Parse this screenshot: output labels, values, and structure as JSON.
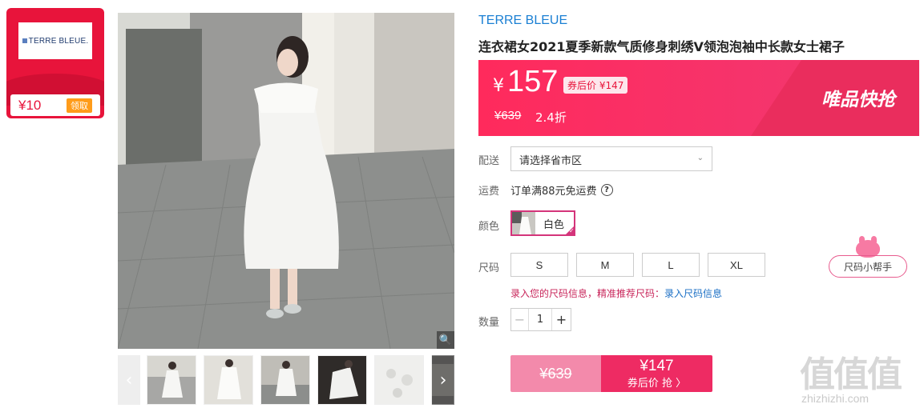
{
  "coupon": {
    "brand_logo_text": "TERRE BLEUE.",
    "amount": "¥10",
    "claim_label": "领取"
  },
  "product": {
    "brand": "TERRE BLEUE",
    "title": "连衣裙女2021夏季新款气质修身刺绣V领泡泡袖中长款女士裙子"
  },
  "price": {
    "currency": "¥",
    "current": "157",
    "after_coupon": "券后价 ¥147",
    "original": "¥639",
    "discount": "2.4折",
    "channel": "唯品快抢"
  },
  "delivery": {
    "label": "配送",
    "placeholder": "请选择省市区"
  },
  "shipping": {
    "label": "运费",
    "text": "订单满88元免运费",
    "help_icon": "?"
  },
  "color": {
    "label": "颜色",
    "selected": "白色"
  },
  "size": {
    "label": "尺码",
    "options": [
      "S",
      "M",
      "L",
      "XL"
    ],
    "helper": "尺码小帮手"
  },
  "size_tip": {
    "text": "录入您的尺码信息，精准推荐尺码：",
    "link": "录入尺码信息"
  },
  "quantity": {
    "label": "数量",
    "minus": "−",
    "value": "1",
    "plus": "+"
  },
  "buy": {
    "original": "¥639",
    "price": "¥147",
    "action": "券后价 抢 〉"
  },
  "gallery": {
    "prev": "‹",
    "next": "›",
    "zoom_icon": "magnifier"
  },
  "watermark": {
    "text": "值值值",
    "url": "zhizhizhi.com"
  }
}
